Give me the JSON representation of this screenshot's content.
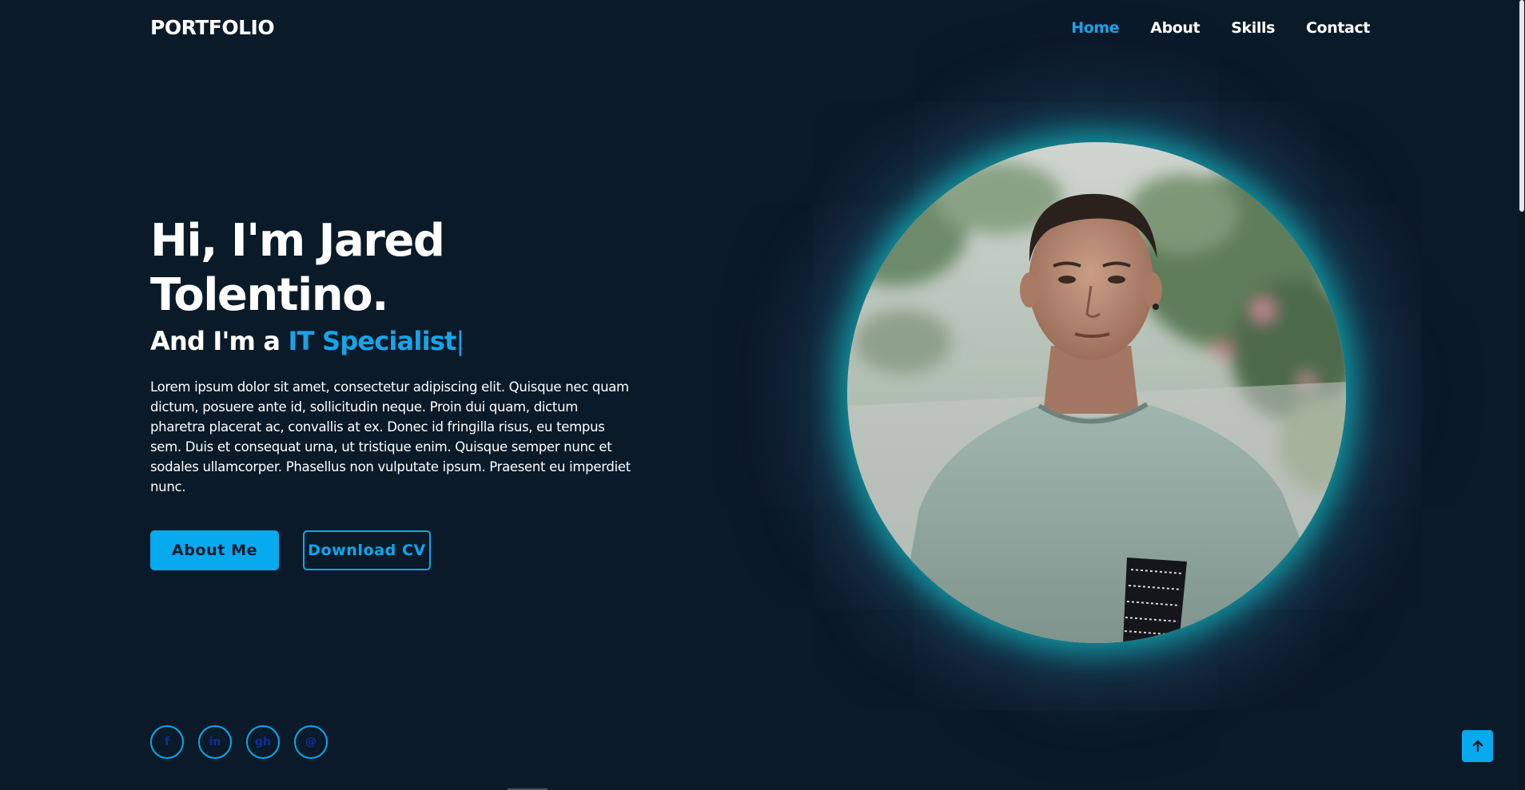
{
  "header": {
    "logo": "PORTFOLIO",
    "nav": [
      {
        "label": "Home",
        "active": true
      },
      {
        "label": "About",
        "active": false
      },
      {
        "label": "Skills",
        "active": false
      },
      {
        "label": "Contact",
        "active": false
      }
    ]
  },
  "hero": {
    "title": "Hi, I'm Jared Tolentino.",
    "subtitle_prefix": "And I'm a ",
    "subtitle_role": "IT Specialist",
    "subtitle_cursor": "|",
    "description": "Lorem ipsum dolor sit amet, consectetur adipiscing elit. Quisque nec quam dictum, posuere ante id, sollicitudin neque. Proin dui quam, dictum pharetra placerat ac, convallis at ex. Donec id fringilla risus, eu tempus sem. Duis et consequat urna, ut tristique enim. Quisque semper nunc et sodales ullamcorper. Phasellus non vulputate ipsum. Praesent eu imperdiet nunc.",
    "buttons": {
      "primary": "About Me",
      "secondary": "Download CV"
    }
  },
  "social": [
    {
      "icon": "facebook-icon",
      "glyph": "f"
    },
    {
      "icon": "linkedin-icon",
      "glyph": "in"
    },
    {
      "icon": "github-icon",
      "glyph": "gh"
    },
    {
      "icon": "email-icon",
      "glyph": "@"
    }
  ],
  "colors": {
    "background": "#0a1a29",
    "accent": "#07a9ef",
    "accent_text": "#19a3e8",
    "glow": "#14dcdc"
  },
  "icons": {
    "back_to_top": "arrow-up-icon"
  }
}
